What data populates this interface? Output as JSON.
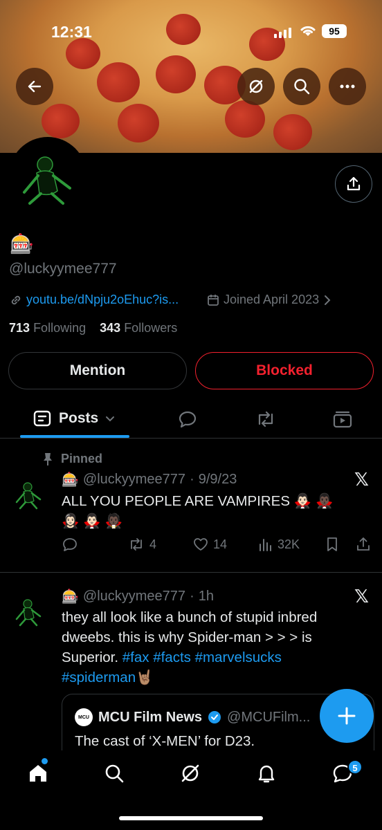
{
  "status_bar": {
    "time": "12:31",
    "battery": "95"
  },
  "profile": {
    "display_name_emoji": "🎰",
    "handle": "@luckyymee777",
    "link": "youtu.be/dNpju2oEhuc?is...",
    "joined": "Joined April 2023",
    "following_count": "713",
    "following_label": "Following",
    "followers_count": "343",
    "followers_label": "Followers"
  },
  "buttons": {
    "mention": "Mention",
    "blocked": "Blocked"
  },
  "tabs": {
    "posts": "Posts"
  },
  "posts": [
    {
      "pinned_label": "Pinned",
      "emoji": "🎰",
      "handle": "@luckyymee777",
      "sep": "·",
      "time": "9/9/23",
      "text": "ALL YOU PEOPLE ARE VAMPIRES 🧛🏻‍♂️ 🧛🏿‍♂️ 🧛🏻‍♀️ 🧛🏻‍♂️ 🧛🏿",
      "replies": "",
      "reposts": "4",
      "likes": "14",
      "views": "32K"
    },
    {
      "emoji": "🎰",
      "handle": "@luckyymee777",
      "sep": "·",
      "time": "1h",
      "text_plain": "they all look like a bunch of stupid inbred dweebs. this is why Spider-man > > > is Superior. ",
      "hashtags": "#fax #facts #marvelsucks",
      "hashtag_last": "#spiderman",
      "text_emoji": "🤘🏽",
      "quote": {
        "logo_text": "MCU",
        "name": "MCU Film News",
        "handle": "@MCUFilm...",
        "text": "The cast of ‘X-MEN’ for D23."
      }
    }
  ],
  "nav": {
    "messages_badge": "5"
  },
  "colors": {
    "accent": "#1d9bf0",
    "danger": "#f4212e",
    "muted": "#71767b"
  }
}
